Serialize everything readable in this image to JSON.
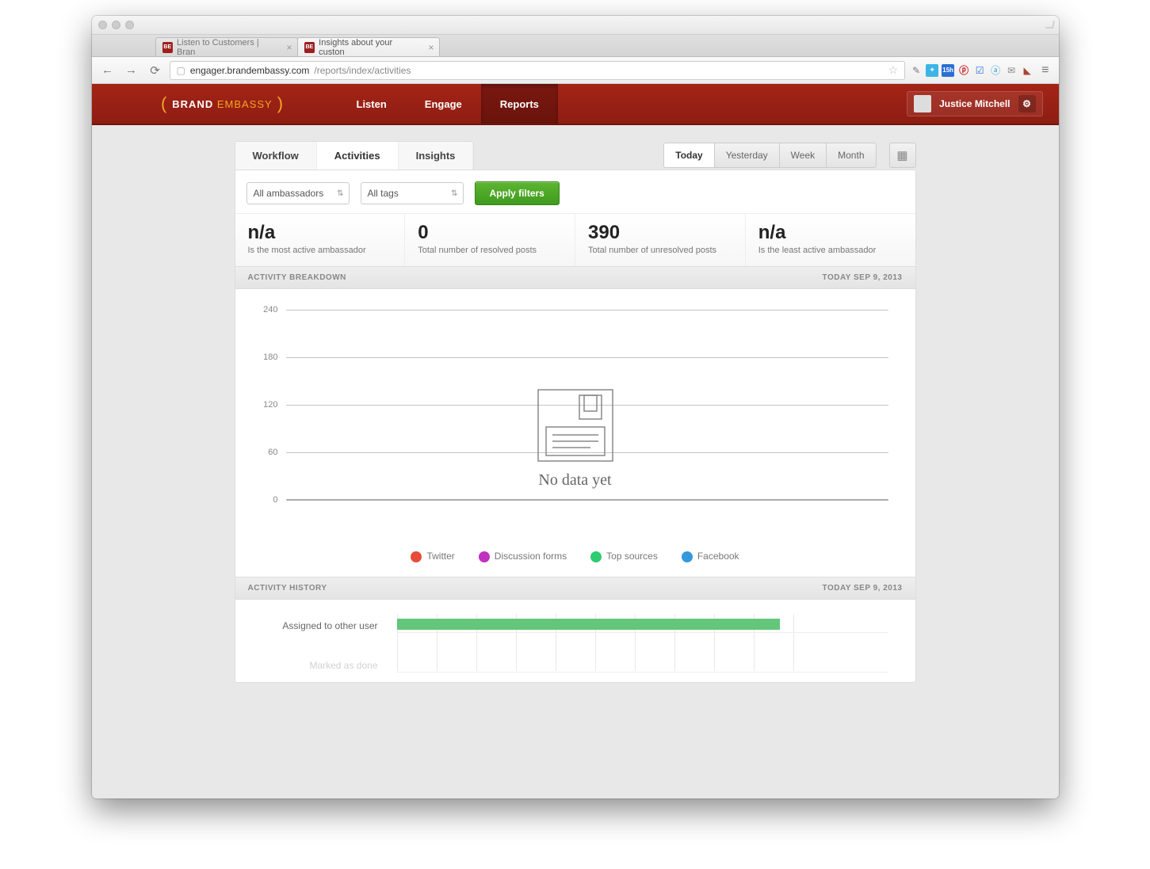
{
  "browser": {
    "tabs": [
      {
        "title": "Listen to Customers | Bran",
        "active": false
      },
      {
        "title": "Insights about your custon",
        "active": true
      }
    ],
    "url_host": "engager.brandembassy.com",
    "url_path": "/reports/index/activities"
  },
  "header": {
    "brand_a": "BRAND",
    "brand_b": "EMBASSY",
    "nav": [
      "Listen",
      "Engage",
      "Reports"
    ],
    "nav_active": "Reports",
    "user_name": "Justice Mitchell"
  },
  "subtabs": {
    "items": [
      "Workflow",
      "Activities",
      "Insights"
    ],
    "active": "Activities"
  },
  "timerange": {
    "items": [
      "Today",
      "Yesterday",
      "Week",
      "Month"
    ],
    "active": "Today"
  },
  "filters": {
    "ambassadors": "All ambassadors",
    "tags": "All tags",
    "apply": "Apply filters"
  },
  "stats": [
    {
      "value": "n/a",
      "label": "Is the most active ambassador"
    },
    {
      "value": "0",
      "label": "Total number of resolved posts"
    },
    {
      "value": "390",
      "label": "Total number of unresolved posts"
    },
    {
      "value": "n/a",
      "label": "Is the least active ambassador"
    }
  ],
  "breakdown": {
    "title": "ACTIVITY BREAKDOWN",
    "date": "TODAY SEP 9, 2013",
    "no_data": "No data yet",
    "legend": [
      {
        "label": "Twitter",
        "color": "#e74c3c"
      },
      {
        "label": "Discussion forms",
        "color": "#c031c0"
      },
      {
        "label": "Top sources",
        "color": "#2ecc71"
      },
      {
        "label": "Facebook",
        "color": "#3498db"
      }
    ]
  },
  "history": {
    "title": "ACTIVITY HISTORY",
    "date": "TODAY SEP 9, 2013",
    "rows": [
      {
        "label": "Assigned to other user"
      },
      {
        "label": "Marked as done"
      }
    ]
  },
  "chart_data": {
    "type": "bar",
    "title": "Activity Breakdown",
    "ylim": [
      0,
      240
    ],
    "yticks": [
      0,
      60,
      120,
      180,
      240
    ],
    "series": [
      {
        "name": "Twitter",
        "values": []
      },
      {
        "name": "Discussion forms",
        "values": []
      },
      {
        "name": "Top sources",
        "values": []
      },
      {
        "name": "Facebook",
        "values": []
      }
    ],
    "empty": true,
    "empty_message": "No data yet"
  }
}
